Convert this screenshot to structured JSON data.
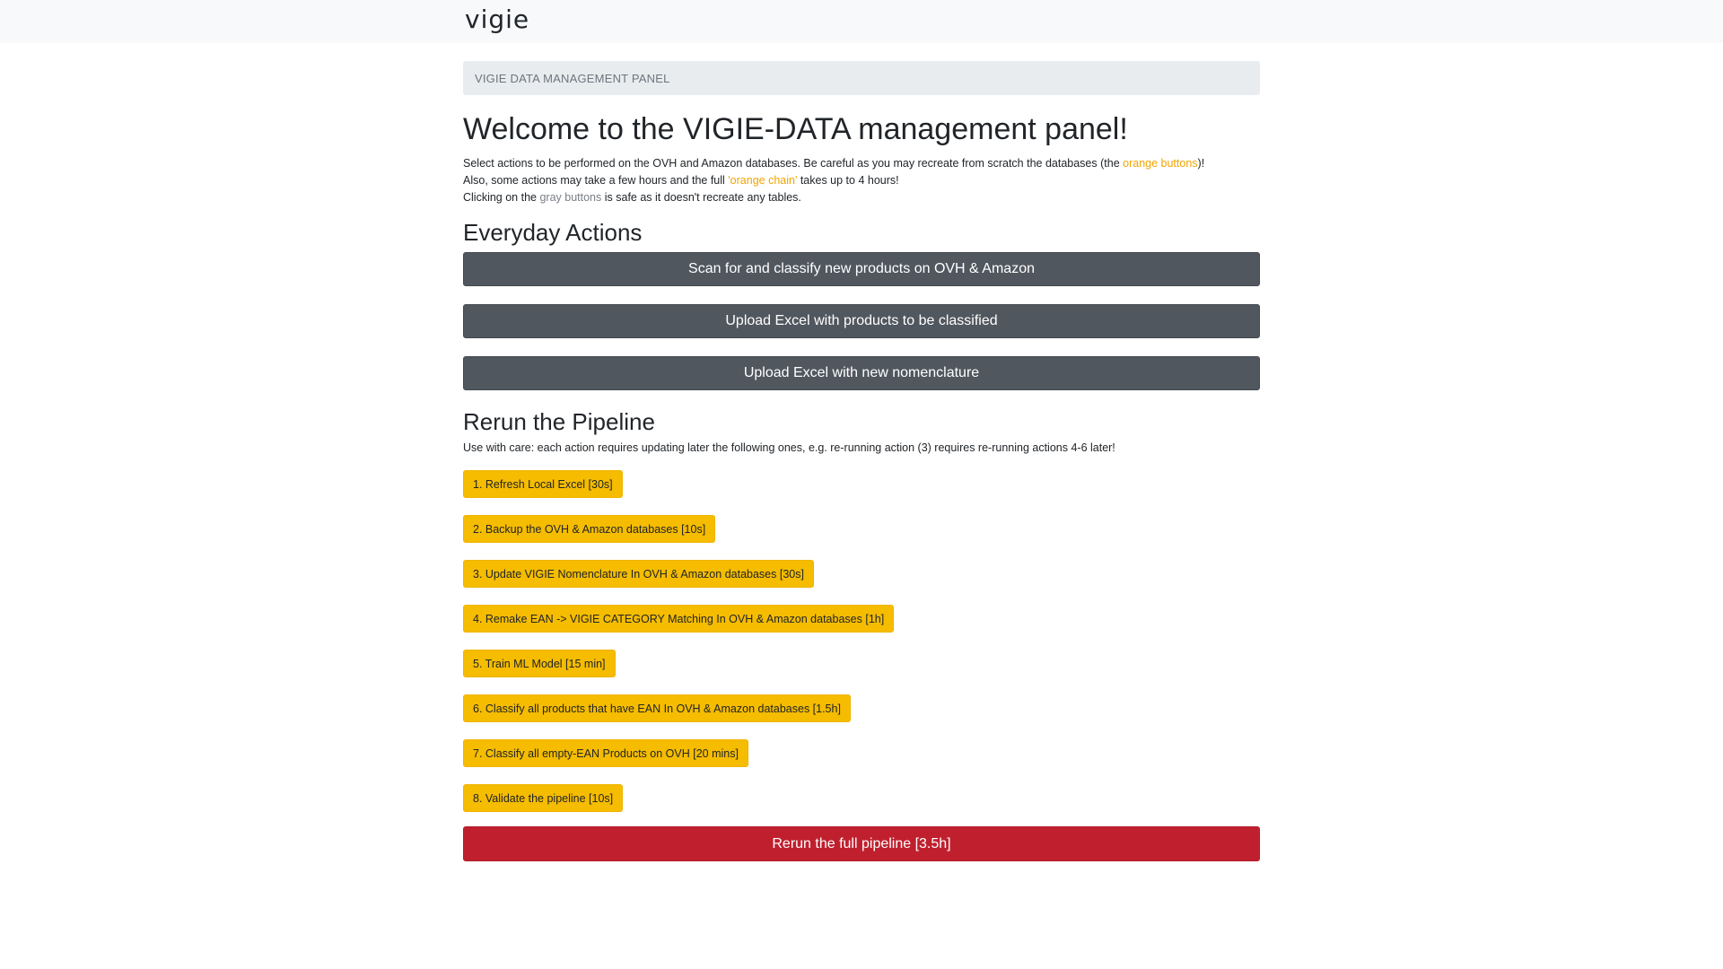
{
  "header": {
    "logo_text": "vigie"
  },
  "breadcrumb": "VIGIE DATA MANAGEMENT PANEL",
  "title": "Welcome to the VIGIE-DATA management panel!",
  "intro": {
    "line1_before": "Select actions to be performed on the OVH and Amazon databases. Be careful as you may recreate from scratch the databases (the ",
    "line1_link": "orange buttons",
    "line1_after": ")!",
    "line2_before": "Also, some actions may take a few hours and the full ",
    "line2_link": "'orange chain'",
    "line2_after": " takes up to 4 hours!",
    "line3_before": "Clicking on the ",
    "line3_link": "gray buttons",
    "line3_after": " is safe as it doesn't recreate any tables."
  },
  "everyday": {
    "heading": "Everyday Actions",
    "buttons": [
      "Scan for and classify new products on OVH & Amazon",
      "Upload Excel with products to be classified",
      "Upload Excel with new nomenclature"
    ]
  },
  "pipeline": {
    "heading": "Rerun the Pipeline",
    "note": "Use with care: each action requires updating later the following ones, e.g. re-running action (3) requires re-running actions 4-6 later!",
    "steps": [
      "1. Refresh Local Excel [30s]",
      "2. Backup the OVH & Amazon databases [10s]",
      "3. Update VIGIE Nomenclature In OVH & Amazon databases [30s]",
      "4. Remake EAN -> VIGIE CATEGORY Matching In OVH & Amazon databases [1h]",
      "5. Train ML Model [15 min]",
      "6. Classify all products that have EAN In OVH & Amazon databases [1.5h]",
      "7. Classify all empty-EAN Products on OVH [20 mins]",
      "8. Validate the pipeline [10s]"
    ],
    "full_rerun": "Rerun the full pipeline [3.5h]"
  },
  "colors": {
    "orange_button": "#f5bc00",
    "gray_button": "#51575e",
    "red_button": "#c0202e",
    "orange_text": "#f0a500",
    "logo_dot": "#2aa7d8"
  }
}
